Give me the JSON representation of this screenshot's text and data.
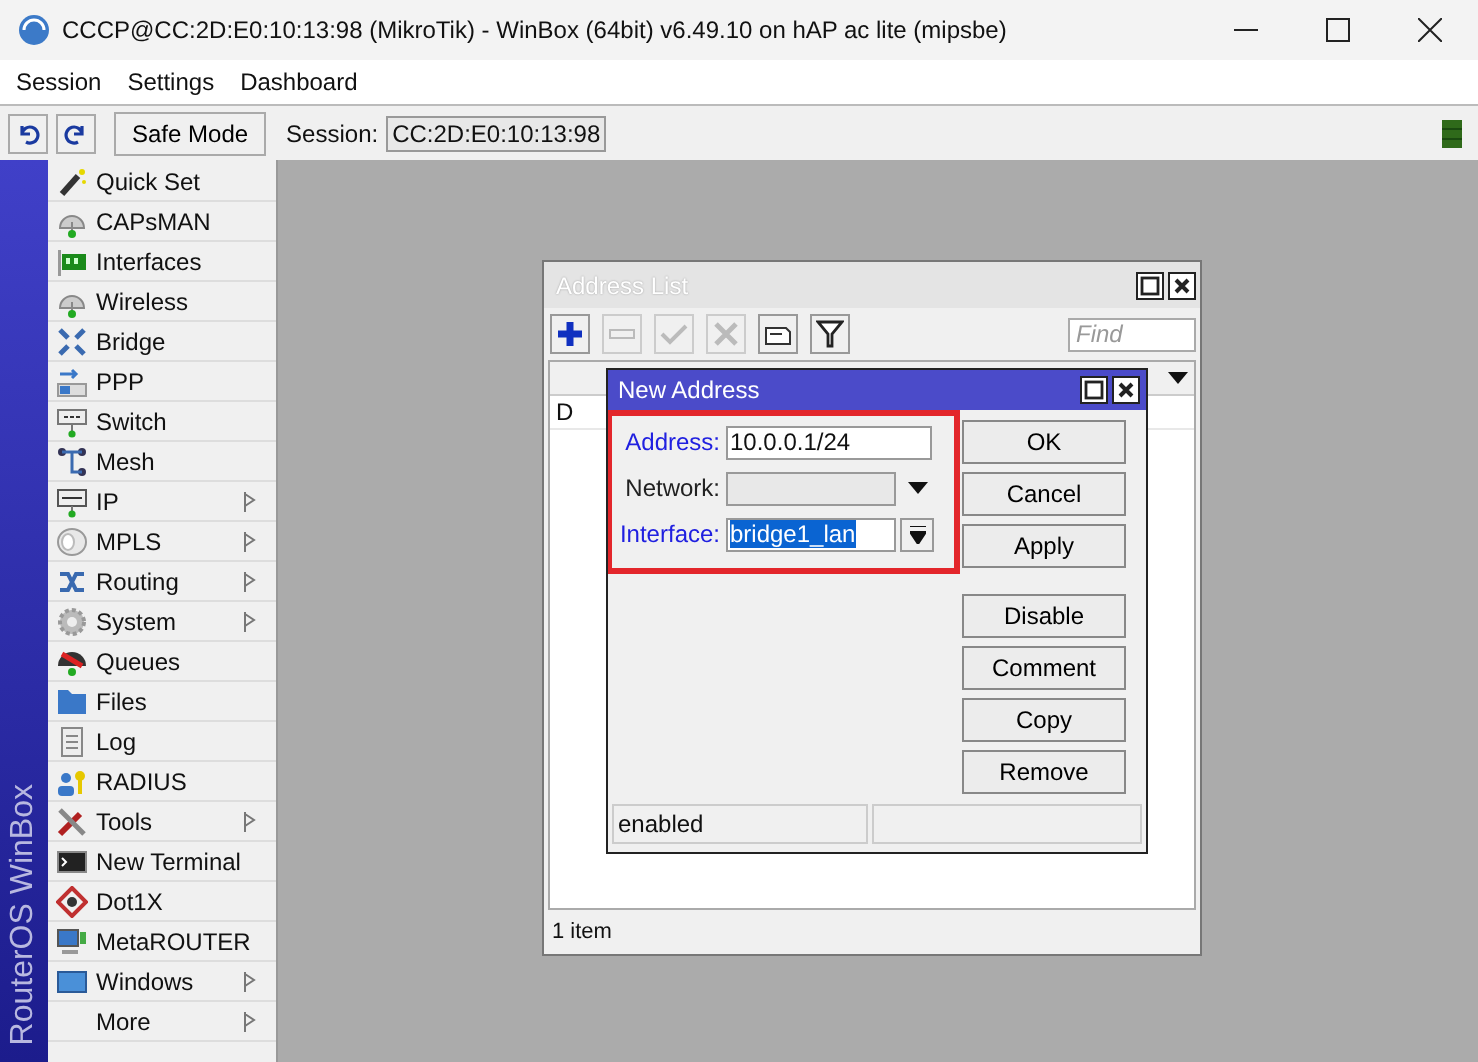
{
  "window": {
    "title": "CCCP@CC:2D:E0:10:13:98 (MikroTik) - WinBox (64bit) v6.49.10 on hAP ac lite (mipsbe)"
  },
  "menu": [
    "Session",
    "Settings",
    "Dashboard"
  ],
  "toolbar": {
    "safe_mode": "Safe Mode",
    "session_label": "Session:",
    "session_value": "CC:2D:E0:10:13:98"
  },
  "sidebar": {
    "brand": "RouterOS WinBox",
    "items": [
      {
        "label": "Quick Set",
        "submenu": false
      },
      {
        "label": "CAPsMAN",
        "submenu": false
      },
      {
        "label": "Interfaces",
        "submenu": false
      },
      {
        "label": "Wireless",
        "submenu": false
      },
      {
        "label": "Bridge",
        "submenu": false
      },
      {
        "label": "PPP",
        "submenu": false
      },
      {
        "label": "Switch",
        "submenu": false
      },
      {
        "label": "Mesh",
        "submenu": false
      },
      {
        "label": "IP",
        "submenu": true
      },
      {
        "label": "MPLS",
        "submenu": true
      },
      {
        "label": "Routing",
        "submenu": true
      },
      {
        "label": "System",
        "submenu": true
      },
      {
        "label": "Queues",
        "submenu": false
      },
      {
        "label": "Files",
        "submenu": false
      },
      {
        "label": "Log",
        "submenu": false
      },
      {
        "label": "RADIUS",
        "submenu": false
      },
      {
        "label": "Tools",
        "submenu": true
      },
      {
        "label": "New Terminal",
        "submenu": false
      },
      {
        "label": "Dot1X",
        "submenu": false
      },
      {
        "label": "MetaROUTER",
        "submenu": false
      },
      {
        "label": "Windows",
        "submenu": true
      },
      {
        "label": "More",
        "submenu": true
      }
    ]
  },
  "address_list": {
    "title": "Address List",
    "tools": [
      {
        "kind": "add",
        "disabled": false
      },
      {
        "kind": "remove",
        "disabled": true
      },
      {
        "kind": "enable",
        "disabled": true
      },
      {
        "kind": "disable",
        "disabled": true
      },
      {
        "kind": "comment",
        "disabled": false
      },
      {
        "kind": "filter",
        "disabled": false
      }
    ],
    "find_placeholder": "Find",
    "rows": [
      {
        "flag": "D"
      }
    ],
    "status": "1 item"
  },
  "new_address": {
    "title": "New Address",
    "fields": [
      {
        "kind": "text",
        "label": "Address:",
        "value": "10.0.0.1/24",
        "highlighted": true,
        "disabled": false
      },
      {
        "kind": "dropdown",
        "label": "Network:",
        "highlighted": false,
        "disabled": true
      },
      {
        "kind": "select",
        "label": "Interface:",
        "value": "bridge1_lan",
        "highlighted": true,
        "disabled": false,
        "text_selected": true
      }
    ],
    "buttons": [
      "OK",
      "Cancel",
      "Apply"
    ],
    "record_buttons": [
      "Disable",
      "Comment",
      "Copy",
      "Remove"
    ],
    "status": "enabled"
  }
}
